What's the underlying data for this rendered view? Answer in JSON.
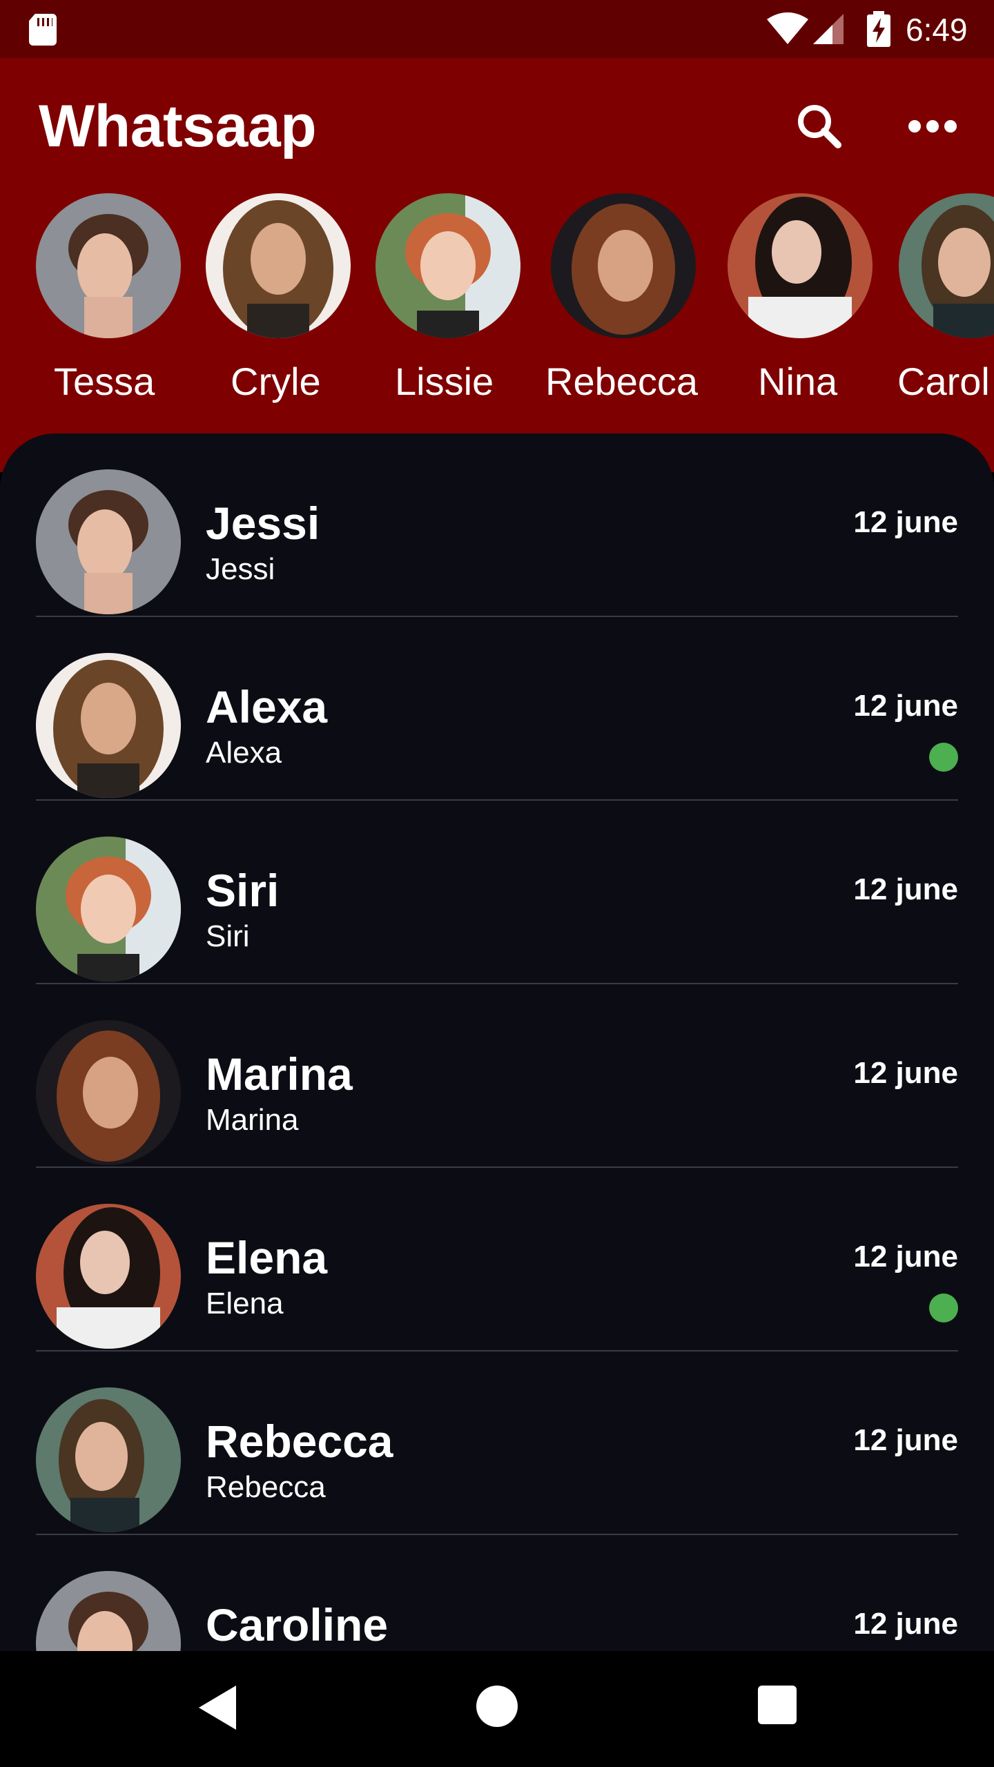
{
  "status_bar": {
    "time": "6:49",
    "icons": [
      "sd-card-icon",
      "wifi-icon",
      "signal-icon",
      "battery-charging-icon"
    ]
  },
  "app_bar": {
    "title": "Whatsaap",
    "actions": [
      "search-icon",
      "more-horizontal-icon"
    ]
  },
  "stories": [
    {
      "name": "Tessa"
    },
    {
      "name": "Cryle"
    },
    {
      "name": "Lissie"
    },
    {
      "name": "Rebecca"
    },
    {
      "name": "Nina"
    },
    {
      "name": "Carol"
    }
  ],
  "chats": [
    {
      "name": "Jessi",
      "message": "Jessi",
      "date": "12 june",
      "online": false
    },
    {
      "name": "Alexa",
      "message": "Alexa",
      "date": "12 june",
      "online": true
    },
    {
      "name": "Siri",
      "message": "Siri",
      "date": "12 june",
      "online": false
    },
    {
      "name": "Marina",
      "message": "Marina",
      "date": "12 june",
      "online": false
    },
    {
      "name": "Elena",
      "message": "Elena",
      "date": "12 june",
      "online": true
    },
    {
      "name": "Rebecca",
      "message": "Rebecca",
      "date": "12 june",
      "online": false
    },
    {
      "name": "Caroline",
      "message": "",
      "date": "12 june",
      "online": false
    }
  ],
  "colors": {
    "status_bar": "#610000",
    "header": "#7f0000",
    "list_background": "#0c0d14",
    "online": "#4caf50"
  },
  "nav_bar": {
    "buttons": [
      "back-icon",
      "home-icon",
      "recents-icon"
    ]
  }
}
